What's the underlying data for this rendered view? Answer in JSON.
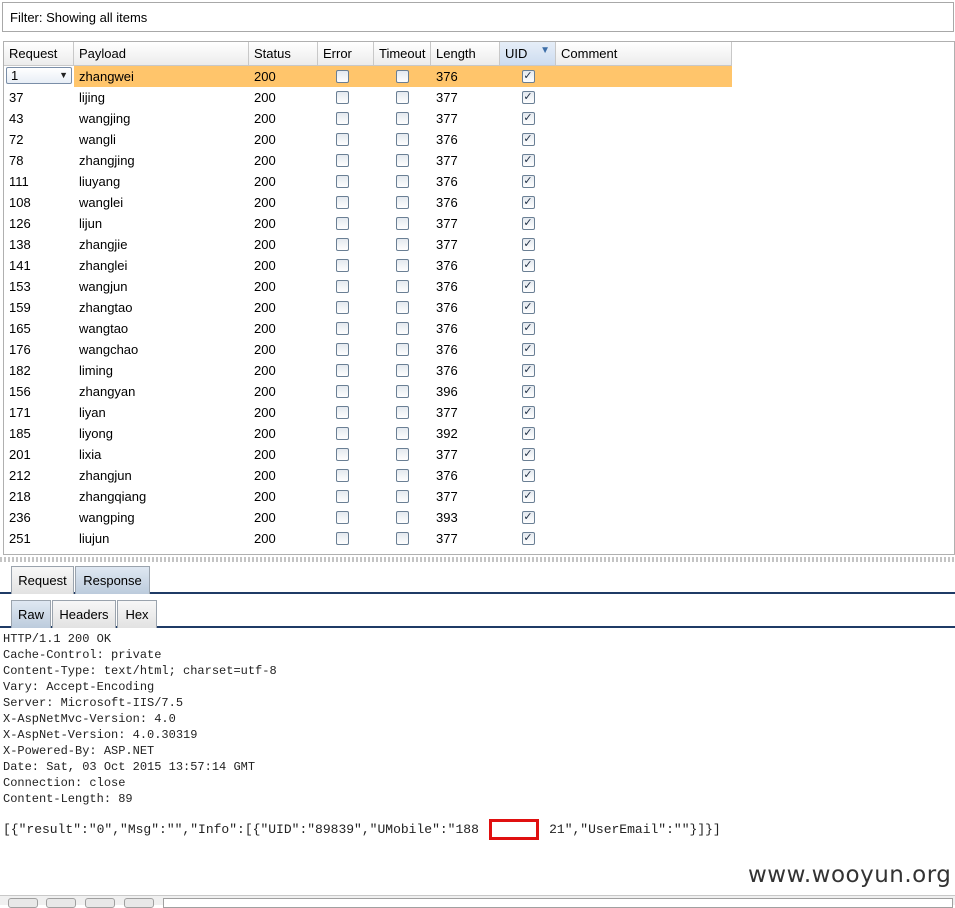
{
  "filter": {
    "text": "Filter: Showing all items"
  },
  "table": {
    "columns": [
      {
        "key": "request",
        "label": "Request"
      },
      {
        "key": "payload",
        "label": "Payload"
      },
      {
        "key": "status",
        "label": "Status"
      },
      {
        "key": "error",
        "label": "Error"
      },
      {
        "key": "timeout",
        "label": "Timeout"
      },
      {
        "key": "length",
        "label": "Length"
      },
      {
        "key": "uid",
        "label": "UID",
        "sorted": true
      },
      {
        "key": "comment",
        "label": "Comment"
      }
    ],
    "rows": [
      {
        "request": "1",
        "payload": "zhangwei",
        "status": "200",
        "error": false,
        "timeout": false,
        "length": "376",
        "uid": true,
        "comment": "",
        "selected": true
      },
      {
        "request": "37",
        "payload": "lijing",
        "status": "200",
        "error": false,
        "timeout": false,
        "length": "377",
        "uid": true,
        "comment": ""
      },
      {
        "request": "43",
        "payload": "wangjing",
        "status": "200",
        "error": false,
        "timeout": false,
        "length": "377",
        "uid": true,
        "comment": ""
      },
      {
        "request": "72",
        "payload": "wangli",
        "status": "200",
        "error": false,
        "timeout": false,
        "length": "376",
        "uid": true,
        "comment": ""
      },
      {
        "request": "78",
        "payload": "zhangjing",
        "status": "200",
        "error": false,
        "timeout": false,
        "length": "377",
        "uid": true,
        "comment": ""
      },
      {
        "request": "111",
        "payload": "liuyang",
        "status": "200",
        "error": false,
        "timeout": false,
        "length": "376",
        "uid": true,
        "comment": ""
      },
      {
        "request": "108",
        "payload": "wanglei",
        "status": "200",
        "error": false,
        "timeout": false,
        "length": "376",
        "uid": true,
        "comment": ""
      },
      {
        "request": "126",
        "payload": "lijun",
        "status": "200",
        "error": false,
        "timeout": false,
        "length": "377",
        "uid": true,
        "comment": ""
      },
      {
        "request": "138",
        "payload": "zhangjie",
        "status": "200",
        "error": false,
        "timeout": false,
        "length": "377",
        "uid": true,
        "comment": ""
      },
      {
        "request": "141",
        "payload": "zhanglei",
        "status": "200",
        "error": false,
        "timeout": false,
        "length": "376",
        "uid": true,
        "comment": ""
      },
      {
        "request": "153",
        "payload": "wangjun",
        "status": "200",
        "error": false,
        "timeout": false,
        "length": "376",
        "uid": true,
        "comment": ""
      },
      {
        "request": "159",
        "payload": "zhangtao",
        "status": "200",
        "error": false,
        "timeout": false,
        "length": "376",
        "uid": true,
        "comment": ""
      },
      {
        "request": "165",
        "payload": "wangtao",
        "status": "200",
        "error": false,
        "timeout": false,
        "length": "376",
        "uid": true,
        "comment": ""
      },
      {
        "request": "176",
        "payload": "wangchao",
        "status": "200",
        "error": false,
        "timeout": false,
        "length": "376",
        "uid": true,
        "comment": ""
      },
      {
        "request": "182",
        "payload": "liming",
        "status": "200",
        "error": false,
        "timeout": false,
        "length": "376",
        "uid": true,
        "comment": ""
      },
      {
        "request": "156",
        "payload": "zhangyan",
        "status": "200",
        "error": false,
        "timeout": false,
        "length": "396",
        "uid": true,
        "comment": ""
      },
      {
        "request": "171",
        "payload": "liyan",
        "status": "200",
        "error": false,
        "timeout": false,
        "length": "377",
        "uid": true,
        "comment": ""
      },
      {
        "request": "185",
        "payload": "liyong",
        "status": "200",
        "error": false,
        "timeout": false,
        "length": "392",
        "uid": true,
        "comment": ""
      },
      {
        "request": "201",
        "payload": "lixia",
        "status": "200",
        "error": false,
        "timeout": false,
        "length": "377",
        "uid": true,
        "comment": ""
      },
      {
        "request": "212",
        "payload": "zhangjun",
        "status": "200",
        "error": false,
        "timeout": false,
        "length": "376",
        "uid": true,
        "comment": ""
      },
      {
        "request": "218",
        "payload": "zhangqiang",
        "status": "200",
        "error": false,
        "timeout": false,
        "length": "377",
        "uid": true,
        "comment": ""
      },
      {
        "request": "236",
        "payload": "wangping",
        "status": "200",
        "error": false,
        "timeout": false,
        "length": "393",
        "uid": true,
        "comment": ""
      },
      {
        "request": "251",
        "payload": "liujun",
        "status": "200",
        "error": false,
        "timeout": false,
        "length": "377",
        "uid": true,
        "comment": ""
      }
    ]
  },
  "tabs_top": [
    {
      "label": "Request",
      "active": false
    },
    {
      "label": "Response",
      "active": true
    }
  ],
  "tabs_sub": [
    {
      "label": "Raw",
      "active": true
    },
    {
      "label": "Headers",
      "active": false
    },
    {
      "label": "Hex",
      "active": false
    }
  ],
  "response": {
    "headers": [
      "HTTP/1.1 200 OK",
      "Cache-Control: private",
      "Content-Type: text/html; charset=utf-8",
      "Vary: Accept-Encoding",
      "Server: Microsoft-IIS/7.5",
      "X-AspNetMvc-Version: 4.0",
      "X-AspNet-Version: 4.0.30319",
      "X-Powered-By: ASP.NET",
      "Date: Sat, 03 Oct 2015 13:57:14 GMT",
      "Connection: close",
      "Content-Length: 89"
    ],
    "body": "[{\"result\":\"0\",\"Msg\":\"\",\"Info\":[{\"UID\":\"89839\",\"UMobile\":\"188         21\",\"UserEmail\":\"\"}]}]"
  },
  "watermark": "www.wooyun.org",
  "icons": {
    "checkbox_checked": "checkmark-icon",
    "combo": "chevron-down-icon",
    "sort": "sort-desc-icon"
  }
}
